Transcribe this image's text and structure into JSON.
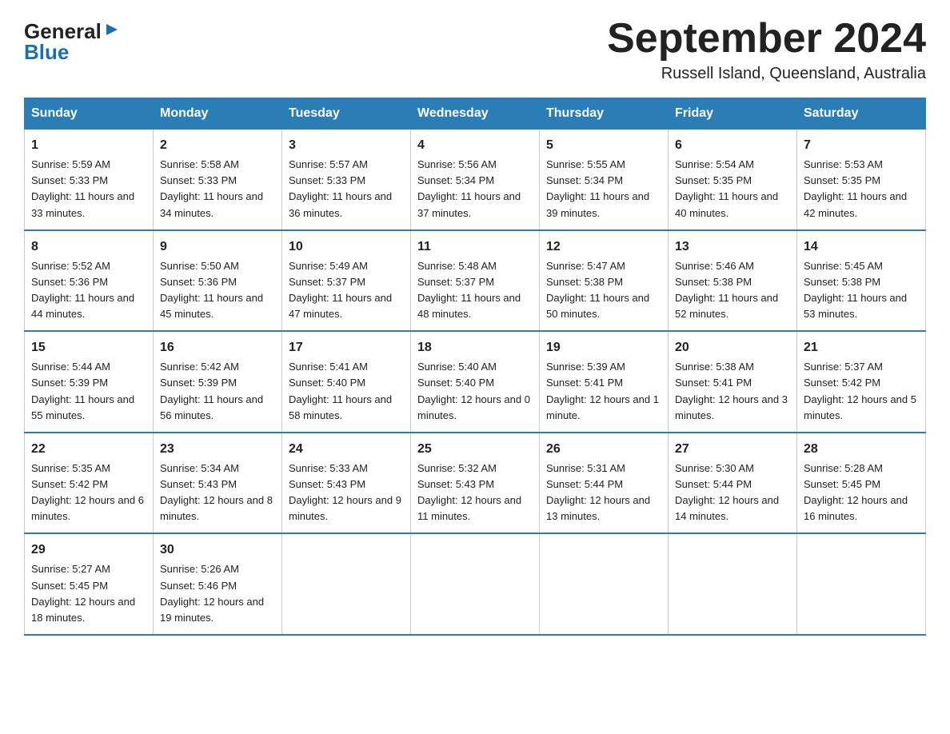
{
  "logo": {
    "line1": "General",
    "arrow": "▶",
    "line2": "Blue"
  },
  "title": "September 2024",
  "location": "Russell Island, Queensland, Australia",
  "weekdays": [
    "Sunday",
    "Monday",
    "Tuesday",
    "Wednesday",
    "Thursday",
    "Friday",
    "Saturday"
  ],
  "weeks": [
    [
      {
        "day": "1",
        "sunrise": "5:59 AM",
        "sunset": "5:33 PM",
        "daylight": "11 hours and 33 minutes."
      },
      {
        "day": "2",
        "sunrise": "5:58 AM",
        "sunset": "5:33 PM",
        "daylight": "11 hours and 34 minutes."
      },
      {
        "day": "3",
        "sunrise": "5:57 AM",
        "sunset": "5:33 PM",
        "daylight": "11 hours and 36 minutes."
      },
      {
        "day": "4",
        "sunrise": "5:56 AM",
        "sunset": "5:34 PM",
        "daylight": "11 hours and 37 minutes."
      },
      {
        "day": "5",
        "sunrise": "5:55 AM",
        "sunset": "5:34 PM",
        "daylight": "11 hours and 39 minutes."
      },
      {
        "day": "6",
        "sunrise": "5:54 AM",
        "sunset": "5:35 PM",
        "daylight": "11 hours and 40 minutes."
      },
      {
        "day": "7",
        "sunrise": "5:53 AM",
        "sunset": "5:35 PM",
        "daylight": "11 hours and 42 minutes."
      }
    ],
    [
      {
        "day": "8",
        "sunrise": "5:52 AM",
        "sunset": "5:36 PM",
        "daylight": "11 hours and 44 minutes."
      },
      {
        "day": "9",
        "sunrise": "5:50 AM",
        "sunset": "5:36 PM",
        "daylight": "11 hours and 45 minutes."
      },
      {
        "day": "10",
        "sunrise": "5:49 AM",
        "sunset": "5:37 PM",
        "daylight": "11 hours and 47 minutes."
      },
      {
        "day": "11",
        "sunrise": "5:48 AM",
        "sunset": "5:37 PM",
        "daylight": "11 hours and 48 minutes."
      },
      {
        "day": "12",
        "sunrise": "5:47 AM",
        "sunset": "5:38 PM",
        "daylight": "11 hours and 50 minutes."
      },
      {
        "day": "13",
        "sunrise": "5:46 AM",
        "sunset": "5:38 PM",
        "daylight": "11 hours and 52 minutes."
      },
      {
        "day": "14",
        "sunrise": "5:45 AM",
        "sunset": "5:38 PM",
        "daylight": "11 hours and 53 minutes."
      }
    ],
    [
      {
        "day": "15",
        "sunrise": "5:44 AM",
        "sunset": "5:39 PM",
        "daylight": "11 hours and 55 minutes."
      },
      {
        "day": "16",
        "sunrise": "5:42 AM",
        "sunset": "5:39 PM",
        "daylight": "11 hours and 56 minutes."
      },
      {
        "day": "17",
        "sunrise": "5:41 AM",
        "sunset": "5:40 PM",
        "daylight": "11 hours and 58 minutes."
      },
      {
        "day": "18",
        "sunrise": "5:40 AM",
        "sunset": "5:40 PM",
        "daylight": "12 hours and 0 minutes."
      },
      {
        "day": "19",
        "sunrise": "5:39 AM",
        "sunset": "5:41 PM",
        "daylight": "12 hours and 1 minute."
      },
      {
        "day": "20",
        "sunrise": "5:38 AM",
        "sunset": "5:41 PM",
        "daylight": "12 hours and 3 minutes."
      },
      {
        "day": "21",
        "sunrise": "5:37 AM",
        "sunset": "5:42 PM",
        "daylight": "12 hours and 5 minutes."
      }
    ],
    [
      {
        "day": "22",
        "sunrise": "5:35 AM",
        "sunset": "5:42 PM",
        "daylight": "12 hours and 6 minutes."
      },
      {
        "day": "23",
        "sunrise": "5:34 AM",
        "sunset": "5:43 PM",
        "daylight": "12 hours and 8 minutes."
      },
      {
        "day": "24",
        "sunrise": "5:33 AM",
        "sunset": "5:43 PM",
        "daylight": "12 hours and 9 minutes."
      },
      {
        "day": "25",
        "sunrise": "5:32 AM",
        "sunset": "5:43 PM",
        "daylight": "12 hours and 11 minutes."
      },
      {
        "day": "26",
        "sunrise": "5:31 AM",
        "sunset": "5:44 PM",
        "daylight": "12 hours and 13 minutes."
      },
      {
        "day": "27",
        "sunrise": "5:30 AM",
        "sunset": "5:44 PM",
        "daylight": "12 hours and 14 minutes."
      },
      {
        "day": "28",
        "sunrise": "5:28 AM",
        "sunset": "5:45 PM",
        "daylight": "12 hours and 16 minutes."
      }
    ],
    [
      {
        "day": "29",
        "sunrise": "5:27 AM",
        "sunset": "5:45 PM",
        "daylight": "12 hours and 18 minutes."
      },
      {
        "day": "30",
        "sunrise": "5:26 AM",
        "sunset": "5:46 PM",
        "daylight": "12 hours and 19 minutes."
      },
      null,
      null,
      null,
      null,
      null
    ]
  ],
  "labels": {
    "sunrise": "Sunrise: ",
    "sunset": "Sunset: ",
    "daylight": "Daylight: "
  }
}
